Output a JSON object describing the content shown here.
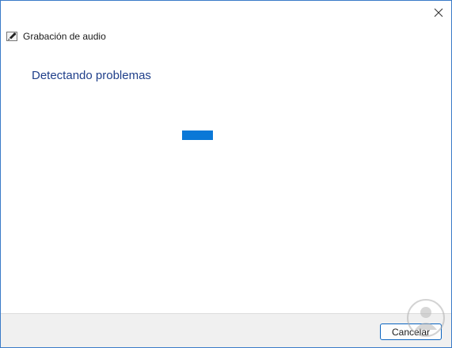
{
  "window": {
    "title": "Grabación de audio",
    "title_icon": "microphone-icon"
  },
  "close": {
    "icon": "close-icon"
  },
  "main": {
    "heading": "Detectando problemas",
    "progress_indicator": "indeterminate",
    "accent_color": "#0a78d7",
    "heading_color": "#1f3f8a"
  },
  "footer": {
    "cancel_label": "Cancelar"
  }
}
